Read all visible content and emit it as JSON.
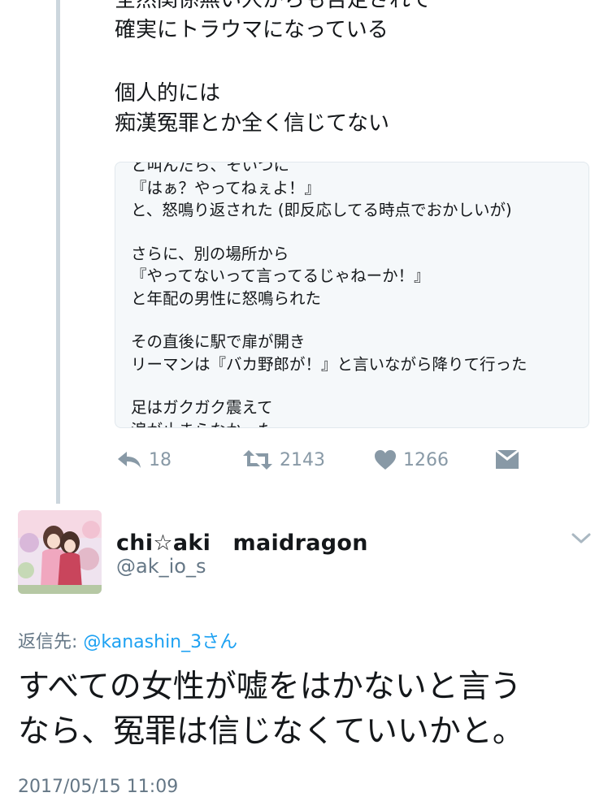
{
  "upper_tweet": {
    "lines_block1": [
      "全然関係無い人からも否定されて",
      "確実にトラウマになっている"
    ],
    "lines_block2": [
      "個人的には",
      "痴漢冤罪とか全く信じてない"
    ]
  },
  "quoted_text": {
    "lines_block1": [
      "と叫んだら、そいつに",
      "『はぁ？やってねぇよ！』",
      "と、怒鳴り返された (即反応してる時点でおかしいが)"
    ],
    "lines_block2": [
      "さらに、別の場所から",
      "『やってないって言ってるじゃねーか！』",
      "と年配の男性に怒鳴られた"
    ],
    "lines_block3": [
      "その直後に駅で扉が開き",
      "リーマンは『バカ野郎が！』と言いながら降りて行った"
    ],
    "lines_block4": [
      "足はガクガク震えて",
      "涙が止まらなかった"
    ]
  },
  "actions": {
    "reply_count": "18",
    "retweet_count": "2143",
    "like_count": "1266",
    "icons": [
      "reply-icon",
      "retweet-icon",
      "heart-icon",
      "message-icon"
    ]
  },
  "reply_tweet": {
    "display_name": "chi☆aki　maidragon",
    "handle": "@ak_io_s",
    "reply_to_prefix": "返信先: ",
    "reply_to_mention": "@kanashin_3さん",
    "text_lines": [
      "すべての女性が嘘をはかないと言う",
      "なら、冤罪は信じなくていいかと。"
    ],
    "timestamp": "2017/05/15 11:09"
  },
  "colors": {
    "text": "#14171a",
    "secondary": "#8899a6",
    "link": "#1da1f2",
    "thread_line": "#ccd6dd",
    "card_bg": "#f5f8fa"
  }
}
